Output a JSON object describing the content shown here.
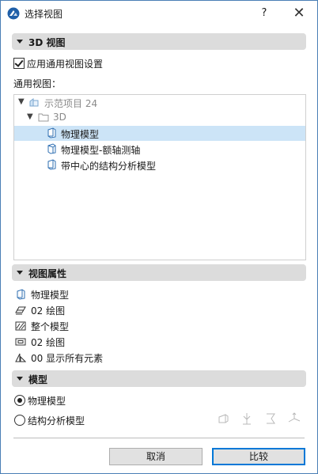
{
  "window": {
    "title": "选择视图",
    "help_label": "?",
    "close_label": "✕"
  },
  "section_3d": {
    "label": "3D 视图"
  },
  "apply_checkbox": {
    "label": "应用通用视图设置",
    "checked": true
  },
  "general_views_label": "通用视图：",
  "tree": {
    "project": "示范项目 24",
    "folder": "3D",
    "items": [
      {
        "label": "物理模型",
        "selected": true
      },
      {
        "label": "物理模型-额轴测轴",
        "selected": false
      },
      {
        "label": "带中心的结构分析模型",
        "selected": false
      }
    ]
  },
  "section_props": {
    "label": "视图属性"
  },
  "properties": [
    {
      "icon": "physical-model-icon",
      "label": "物理模型"
    },
    {
      "icon": "pen-set-icon",
      "label": "02 绘图"
    },
    {
      "icon": "model-view-icon",
      "label": "整个模型"
    },
    {
      "icon": "graphic-override-icon",
      "label": "02 绘图"
    },
    {
      "icon": "renovation-filter-icon",
      "label": "00 显示所有元素"
    }
  ],
  "section_model": {
    "label": "模型"
  },
  "model_options": [
    {
      "label": "物理模型",
      "selected": true
    },
    {
      "label": "结构分析模型",
      "selected": false
    }
  ],
  "buttons": {
    "cancel": "取消",
    "compare": "比较"
  }
}
